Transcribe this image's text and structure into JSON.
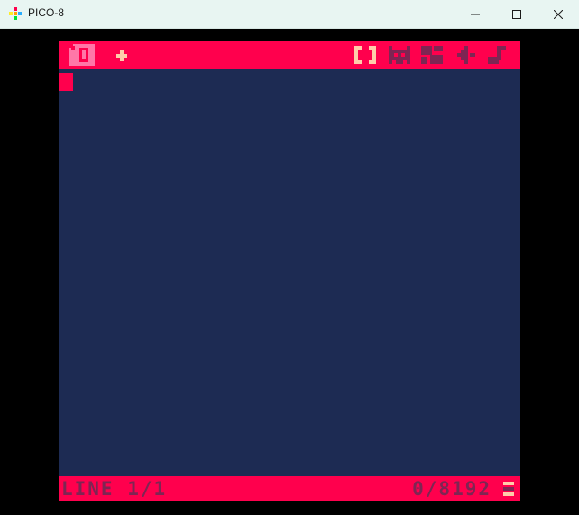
{
  "window": {
    "title": "PICO-8"
  },
  "editor": {
    "tabs": [
      {
        "label": "0",
        "active": true
      },
      {
        "label": "+",
        "active": false
      }
    ],
    "modes": [
      {
        "name": "code-editor",
        "icon": "curly-braces-icon",
        "active": true
      },
      {
        "name": "sprite-editor",
        "icon": "sprite-cat-icon",
        "active": false
      },
      {
        "name": "map-editor",
        "icon": "map-grid-icon",
        "active": false
      },
      {
        "name": "sfx-editor",
        "icon": "speaker-icon",
        "active": false
      },
      {
        "name": "music-editor",
        "icon": "music-note-icon",
        "active": false
      }
    ],
    "status": {
      "line": "LINE 1/1",
      "tokens": "0/8192"
    }
  },
  "colors": {
    "background": "#1d2b53",
    "bar": "#ff004d",
    "dim": "#7e2553",
    "highlight": "#ffccaa",
    "tab_active": "#ff77a8"
  }
}
